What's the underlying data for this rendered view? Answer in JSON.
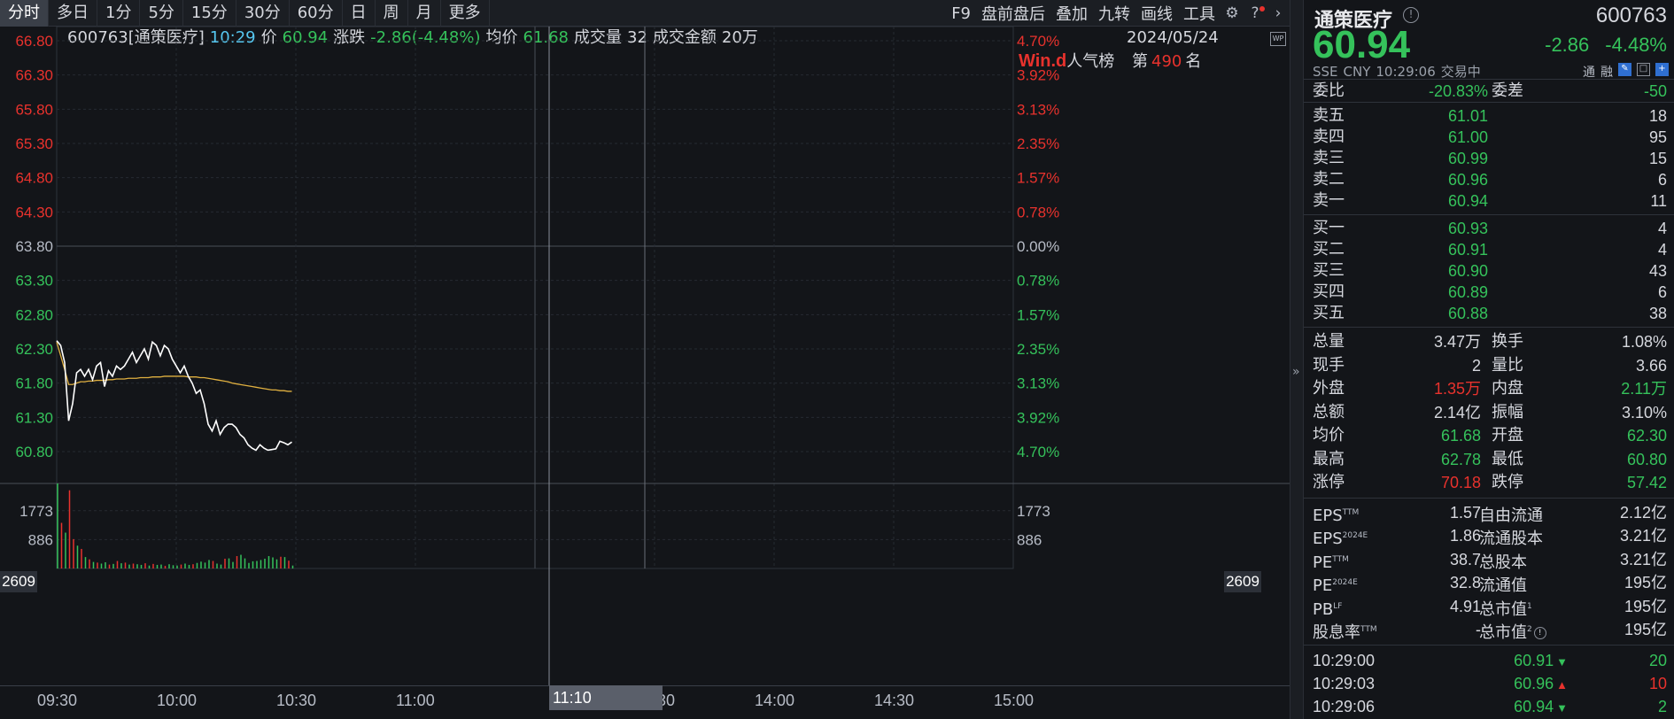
{
  "toolbar": {
    "tabs": [
      "分时",
      "多日",
      "1分",
      "5分",
      "15分",
      "30分",
      "60分",
      "日",
      "周",
      "月",
      "更多"
    ],
    "active_tab": "分时",
    "tools": [
      "F9",
      "盘前盘后",
      "叠加",
      "九转",
      "画线",
      "工具"
    ]
  },
  "info_line": {
    "code_name": "600763[通策医疗]",
    "time": "10:29",
    "price_label": "价",
    "price": "60.94",
    "change_label": "涨跌",
    "change": "-2.86(-4.48%)",
    "avg_label": "均价",
    "avg": "61.68",
    "vol_label": "成交量",
    "vol": "32",
    "amt_label": "成交金额",
    "amt": "20万",
    "date": "2024/05/24",
    "wp": "WP"
  },
  "rank": {
    "logo_a": "Win",
    "logo_b": ".d",
    "label": "人气榜",
    "prefix": "第",
    "value": "490",
    "suffix": "名"
  },
  "price_axis": {
    "left": [
      "66.80",
      "66.30",
      "65.80",
      "65.30",
      "64.80",
      "64.30",
      "63.80",
      "63.30",
      "62.80",
      "62.30",
      "61.80",
      "61.30",
      "60.80"
    ],
    "right": [
      "4.70%",
      "3.92%",
      "3.13%",
      "2.35%",
      "1.57%",
      "0.78%",
      "0.00%",
      "0.78%",
      "1.57%",
      "2.35%",
      "3.13%",
      "3.92%",
      "4.70%"
    ]
  },
  "volume_axis": {
    "max": "2609",
    "ticks": [
      "1773",
      "886"
    ]
  },
  "time_axis": {
    "labels": [
      "09:30",
      "10:00",
      "10:30",
      "11:00",
      "13:30",
      "14:00",
      "14:30",
      "15:00"
    ],
    "cursor": "11:10"
  },
  "colors": {
    "up": "#e8322d",
    "down": "#35c25b",
    "price_line": "#ffffff",
    "avg_line": "#e0b040",
    "background": "#131519"
  },
  "chart_data": {
    "type": "line",
    "title": "",
    "xlabel": "",
    "ylabel": "",
    "ylim": [
      60.8,
      66.8
    ],
    "prev_close": 63.8,
    "x_range": [
      "09:30",
      "15:00"
    ],
    "series": [
      {
        "values_time": [
          "09:30",
          "09:31",
          "09:32",
          "09:33",
          "09:34",
          "09:35",
          "09:36",
          "09:37",
          "09:38",
          "09:39",
          "09:40",
          "09:41",
          "09:42",
          "09:43",
          "09:44",
          "09:45",
          "09:46",
          "09:47",
          "09:48",
          "09:49",
          "09:50",
          "09:51",
          "09:52",
          "09:53",
          "09:54",
          "09:55",
          "09:56",
          "09:57",
          "09:58",
          "09:59",
          "10:00",
          "10:01",
          "10:02",
          "10:03",
          "10:04",
          "10:05",
          "10:06",
          "10:07",
          "10:08",
          "10:09",
          "10:10",
          "10:11",
          "10:12",
          "10:13",
          "10:14",
          "10:15",
          "10:16",
          "10:17",
          "10:18",
          "10:19",
          "10:20",
          "10:21",
          "10:22",
          "10:23",
          "10:24",
          "10:25",
          "10:26",
          "10:27",
          "10:28",
          "10:29"
        ],
        "values": [
          62.42,
          62.35,
          62.1,
          61.25,
          61.5,
          61.95,
          62.0,
          61.9,
          62.0,
          61.85,
          62.05,
          62.1,
          61.75,
          61.98,
          61.9,
          62.05,
          62.0,
          62.05,
          62.15,
          62.25,
          62.1,
          62.2,
          62.3,
          62.15,
          62.4,
          62.35,
          62.2,
          62.35,
          62.3,
          62.15,
          62.05,
          61.95,
          62.05,
          61.9,
          61.8,
          61.65,
          61.7,
          61.5,
          61.2,
          61.1,
          61.25,
          61.05,
          61.15,
          61.2,
          61.2,
          61.15,
          61.05,
          61.0,
          60.9,
          60.85,
          60.82,
          60.9,
          60.85,
          60.82,
          60.83,
          60.84,
          60.95,
          60.93,
          60.9,
          60.94
        ]
      },
      {
        "values": [
          62.4,
          62.2,
          62.0,
          61.78,
          61.78,
          61.8,
          61.82,
          61.82,
          61.83,
          61.83,
          61.84,
          61.84,
          61.84,
          61.85,
          61.85,
          61.86,
          61.86,
          61.86,
          61.87,
          61.87,
          61.87,
          61.88,
          61.88,
          61.88,
          61.89,
          61.89,
          61.89,
          61.9,
          61.9,
          61.9,
          61.9,
          61.9,
          61.9,
          61.89,
          61.89,
          61.89,
          61.88,
          61.88,
          61.87,
          61.86,
          61.85,
          61.84,
          61.83,
          61.82,
          61.8,
          61.79,
          61.78,
          61.77,
          61.76,
          61.75,
          61.74,
          61.73,
          61.72,
          61.71,
          61.7,
          61.7,
          61.69,
          61.69,
          61.68,
          61.68
        ]
      }
    ],
    "volume": {
      "ylim": [
        0,
        2609
      ],
      "values": [
        2609,
        1400,
        1100,
        2400,
        900,
        700,
        600,
        350,
        280,
        200,
        180,
        150,
        190,
        120,
        140,
        230,
        160,
        180,
        120,
        150,
        130,
        110,
        160,
        90,
        140,
        110,
        120,
        80,
        130,
        100,
        90,
        120,
        150,
        110,
        130,
        170,
        210,
        180,
        260,
        230,
        150,
        120,
        300,
        310,
        200,
        380,
        420,
        310,
        170,
        220,
        230,
        260,
        300,
        380,
        340,
        280,
        360,
        350,
        240,
        90
      ],
      "colors_up": [
        false,
        true,
        false,
        true,
        true,
        false,
        true,
        false,
        true,
        false,
        true,
        false,
        false,
        true,
        false,
        true,
        false,
        true,
        false,
        true,
        false,
        false,
        true,
        false,
        true,
        false,
        false,
        true,
        false,
        false,
        false,
        true,
        false,
        false,
        true,
        false,
        false,
        false,
        false,
        true,
        false,
        false,
        true,
        false,
        false,
        true,
        false,
        false,
        false,
        false,
        false,
        false,
        false,
        false,
        false,
        false,
        true,
        false,
        true,
        false
      ]
    }
  },
  "panel": {
    "name": "通策医疗",
    "code": "600763",
    "price": "60.94",
    "change": "-2.86",
    "change_pct": "-4.48%",
    "exchange": "SSE",
    "currency": "CNY",
    "time": "10:29:06",
    "status": "交易中",
    "mini": [
      "通",
      "融"
    ],
    "weibi_label": "委比",
    "weibi": "-20.83%",
    "weicha_label": "委差",
    "weicha": "-50",
    "asks": [
      {
        "label": "卖五",
        "price": "61.01",
        "vol": "18"
      },
      {
        "label": "卖四",
        "price": "61.00",
        "vol": "95"
      },
      {
        "label": "卖三",
        "price": "60.99",
        "vol": "15"
      },
      {
        "label": "卖二",
        "price": "60.96",
        "vol": "6"
      },
      {
        "label": "卖一",
        "price": "60.94",
        "vol": "11"
      }
    ],
    "bids": [
      {
        "label": "买一",
        "price": "60.93",
        "vol": "4"
      },
      {
        "label": "买二",
        "price": "60.91",
        "vol": "4"
      },
      {
        "label": "买三",
        "price": "60.90",
        "vol": "43"
      },
      {
        "label": "买四",
        "price": "60.89",
        "vol": "6"
      },
      {
        "label": "买五",
        "price": "60.88",
        "vol": "38"
      }
    ],
    "stats": [
      {
        "l": "总量",
        "v": "3.47万",
        "vc": "w",
        "l2": "换手",
        "v2": "1.08%",
        "v2c": "w"
      },
      {
        "l": "现手",
        "v": "2",
        "vc": "w",
        "l2": "量比",
        "v2": "3.66",
        "v2c": "w"
      },
      {
        "l": "外盘",
        "v": "1.35万",
        "vc": "r",
        "l2": "内盘",
        "v2": "2.11万",
        "v2c": "g"
      },
      {
        "l": "总额",
        "v": "2.14亿",
        "vc": "w",
        "l2": "振幅",
        "v2": "3.10%",
        "v2c": "w"
      },
      {
        "l": "均价",
        "v": "61.68",
        "vc": "g",
        "l2": "开盘",
        "v2": "62.30",
        "v2c": "g"
      },
      {
        "l": "最高",
        "v": "62.78",
        "vc": "g",
        "l2": "最低",
        "v2": "60.80",
        "v2c": "g"
      },
      {
        "l": "涨停",
        "v": "70.18",
        "vc": "r",
        "l2": "跌停",
        "v2": "57.42",
        "v2c": "g"
      }
    ],
    "fundamentals": [
      {
        "l": "EPS",
        "sup": "TTM",
        "v": "1.57",
        "l2": "自由流通",
        "sup2": "",
        "v2": "2.12亿"
      },
      {
        "l": "EPS",
        "sup": "2024E",
        "v": "1.86",
        "l2": "流通股本",
        "sup2": "",
        "v2": "3.21亿"
      },
      {
        "l": "PE",
        "sup": "TTM",
        "v": "38.7",
        "l2": "总股本",
        "sup2": "",
        "v2": "3.21亿"
      },
      {
        "l": "PE",
        "sup": "2024E",
        "v": "32.8",
        "l2": "流通值",
        "sup2": "",
        "v2": "195亿"
      },
      {
        "l": "PB",
        "sup": "LF",
        "v": "4.91",
        "l2": "总市值",
        "sup2": "1",
        "v2": "195亿"
      },
      {
        "l": "股息率",
        "sup": "TTM",
        "v": "-",
        "l2": "总市值",
        "sup2": "2",
        "v2": "195亿"
      }
    ],
    "trades": [
      {
        "time": "10:29:00",
        "price": "60.91",
        "dir": "down",
        "vol": "20",
        "volc": "g"
      },
      {
        "time": "10:29:03",
        "price": "60.96",
        "dir": "up",
        "vol": "10",
        "volc": "r"
      },
      {
        "time": "10:29:06",
        "price": "60.94",
        "dir": "down",
        "vol": "2",
        "volc": "g"
      }
    ]
  }
}
